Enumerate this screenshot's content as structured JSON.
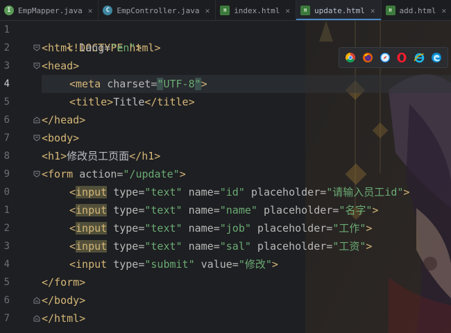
{
  "tabs": [
    {
      "label": "EmpMapper.java",
      "icon": "interface-icon",
      "active": false
    },
    {
      "label": "EmpController.java",
      "icon": "class-icon",
      "active": false
    },
    {
      "label": "index.html",
      "icon": "html-file-icon",
      "active": false
    },
    {
      "label": "update.html",
      "icon": "html-file-icon",
      "active": true
    },
    {
      "label": "add.html",
      "icon": "html-file-icon",
      "active": false
    }
  ],
  "gutter": {
    "line_numbers": [
      "1",
      "2",
      "3",
      "4",
      "5",
      "6",
      "7",
      "8",
      "9",
      "0",
      "1",
      "2",
      "3",
      "4",
      "5",
      "6",
      "7"
    ],
    "current_line": "4"
  },
  "code": {
    "l1": "<!DOCTYPE html>",
    "l2_open": "<html ",
    "l2_attr": "lang=",
    "l2_val": "\"en\"",
    "l2_close": ">",
    "l3": "<head>",
    "l4_open": "<meta ",
    "l4_attr": "charset=",
    "l4_q1": "\"",
    "l4_val": "UTF-8",
    "l4_q2": "\"",
    "l4_close": ">",
    "l5_open": "<title>",
    "l5_text": "Title",
    "l5_close": "</title>",
    "l6": "</head>",
    "l7": "<body>",
    "l8_open": "<h1>",
    "l8_text": "修改员工页面",
    "l8_close": "</h1>",
    "l9_open": "<form ",
    "l9_attr": "action=",
    "l9_val": "\"/update\"",
    "l9_close": ">",
    "input_lt": "<",
    "input_kw": "input",
    "type_attr": " type=",
    "text_val": "\"text\"",
    "name_attr": " name=",
    "ph_attr": " placeholder=",
    "gt": ">",
    "l10_name": "\"id\"",
    "l10_ph": "\"请输入员工id\"",
    "l11_name": "\"name\"",
    "l11_ph": "\"名字\"",
    "l12_name": "\"job\"",
    "l12_ph": "\"工作\"",
    "l13_name": "\"sal\"",
    "l13_ph": "\"工资\"",
    "l14_open": "<input ",
    "l14_type": "type=",
    "l14_type_val": "\"submit\"",
    "l14_value": " value=",
    "l14_value_val": "\"修改\"",
    "l14_close": ">",
    "l15": "</form>",
    "l16": "</body>",
    "l17": "</html>"
  },
  "browser_icons": [
    "chrome-icon",
    "firefox-icon",
    "safari-icon",
    "opera-icon",
    "ie-icon",
    "edge-icon"
  ],
  "colors": {
    "tag": "#d5b778",
    "string": "#6aab73",
    "attribute": "#bababa",
    "text": "#bcbec4",
    "line_number": "#6b6f76",
    "active_tab_accent": "#4a88c7",
    "background": "#1e1f22"
  }
}
